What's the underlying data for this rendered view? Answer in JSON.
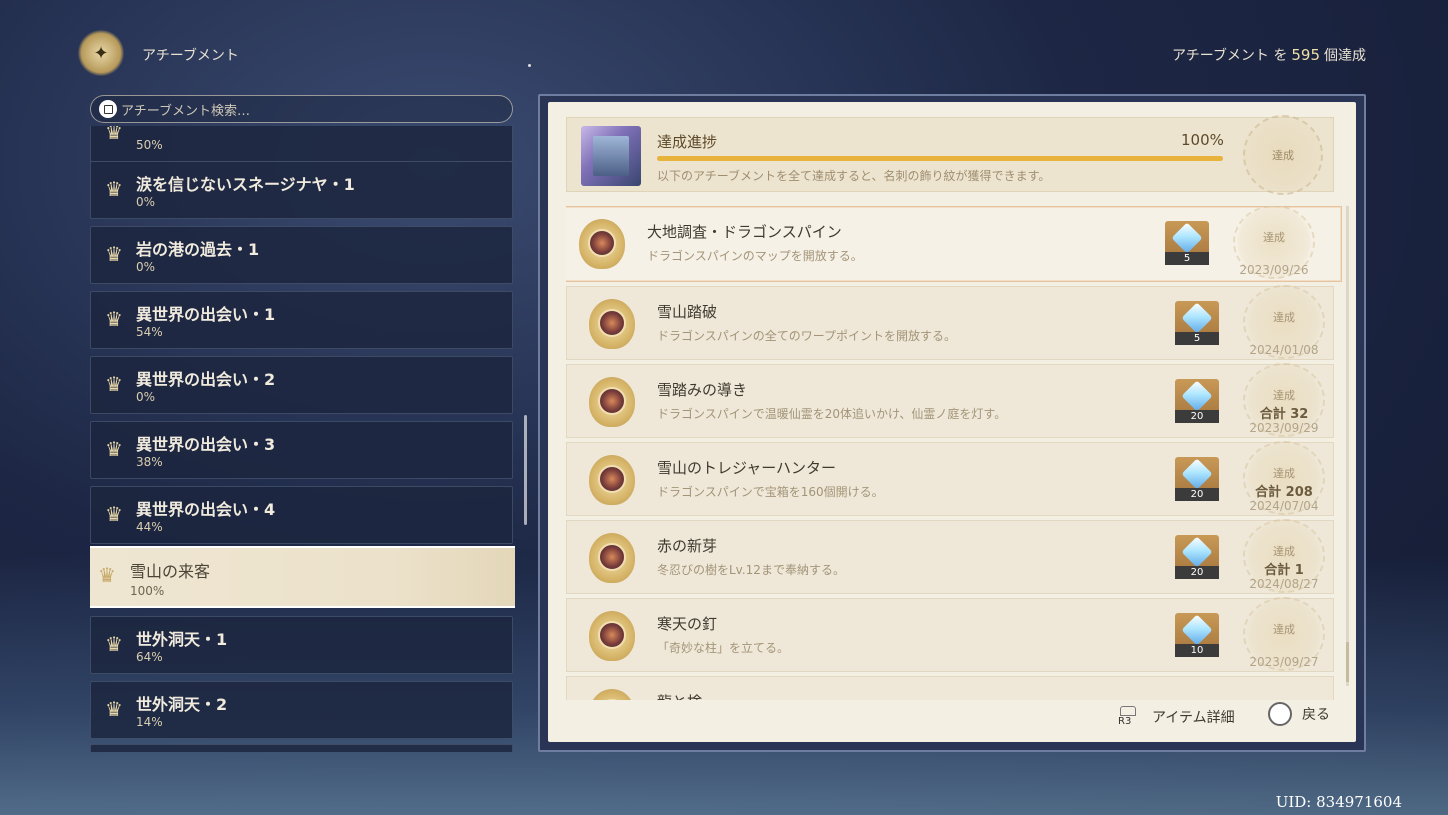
{
  "header": {
    "title": "アチーブメント",
    "count_prefix": "アチーブメント を",
    "count": "595",
    "count_suffix": "個達成"
  },
  "search": {
    "placeholder": "アチーブメント検索…"
  },
  "categories": [
    {
      "name": "",
      "pct": "50%"
    },
    {
      "name": "涙を信じないスネージナヤ・1",
      "pct": "0%"
    },
    {
      "name": "岩の港の過去・1",
      "pct": "0%"
    },
    {
      "name": "異世界の出会い・1",
      "pct": "54%"
    },
    {
      "name": "異世界の出会い・2",
      "pct": "0%"
    },
    {
      "name": "異世界の出会い・3",
      "pct": "38%"
    },
    {
      "name": "異世界の出会い・4",
      "pct": "44%"
    },
    {
      "name": "雪山の来客",
      "pct": "100%",
      "selected": true
    },
    {
      "name": "世外洞天・1",
      "pct": "64%"
    },
    {
      "name": "世外洞天・2",
      "pct": "14%"
    }
  ],
  "progress": {
    "title": "達成進捗",
    "value_text": "100%",
    "value": 1.0,
    "description": "以下のアチーブメントを全て達成すると、名刺の飾り紋が獲得できます。",
    "stamp": "達成"
  },
  "achievements": [
    {
      "title": "大地調査・ドラゴンスパイン",
      "desc": "ドラゴンスパインのマップを開放する。",
      "reward_qty": "5",
      "stamp": "達成",
      "total": "",
      "date": "2023/09/26"
    },
    {
      "title": "雪山踏破",
      "desc": "ドラゴンスパインの全てのワープポイントを開放する。",
      "reward_qty": "5",
      "stamp": "達成",
      "total": "",
      "date": "2024/01/08"
    },
    {
      "title": "雪踏みの導き",
      "desc": "ドラゴンスパインで温暖仙霊を20体追いかけ、仙霊ノ庭を灯す。",
      "reward_qty": "20",
      "stamp": "達成",
      "total": "合計 32",
      "date": "2023/09/29"
    },
    {
      "title": "雪山のトレジャーハンター",
      "desc": "ドラゴンスパインで宝箱を160個開ける。",
      "reward_qty": "20",
      "stamp": "達成",
      "total": "合計 208",
      "date": "2024/07/04"
    },
    {
      "title": "赤の新芽",
      "desc": "冬忍びの樹をLv.12まで奉納する。",
      "reward_qty": "20",
      "stamp": "達成",
      "total": "合計 1",
      "date": "2024/08/27"
    },
    {
      "title": "寒天の釘",
      "desc": "「奇妙な柱」を立てる。",
      "reward_qty": "10",
      "stamp": "達成",
      "total": "",
      "date": "2023/09/27"
    },
    {
      "title": "龍と検",
      "desc": "",
      "reward_qty": "",
      "stamp": "",
      "total": "",
      "date": ""
    }
  ],
  "footer": {
    "r3_label": "R3",
    "detail": "アイテム詳細",
    "back": "戻る"
  },
  "uid": "UID: 834971604"
}
